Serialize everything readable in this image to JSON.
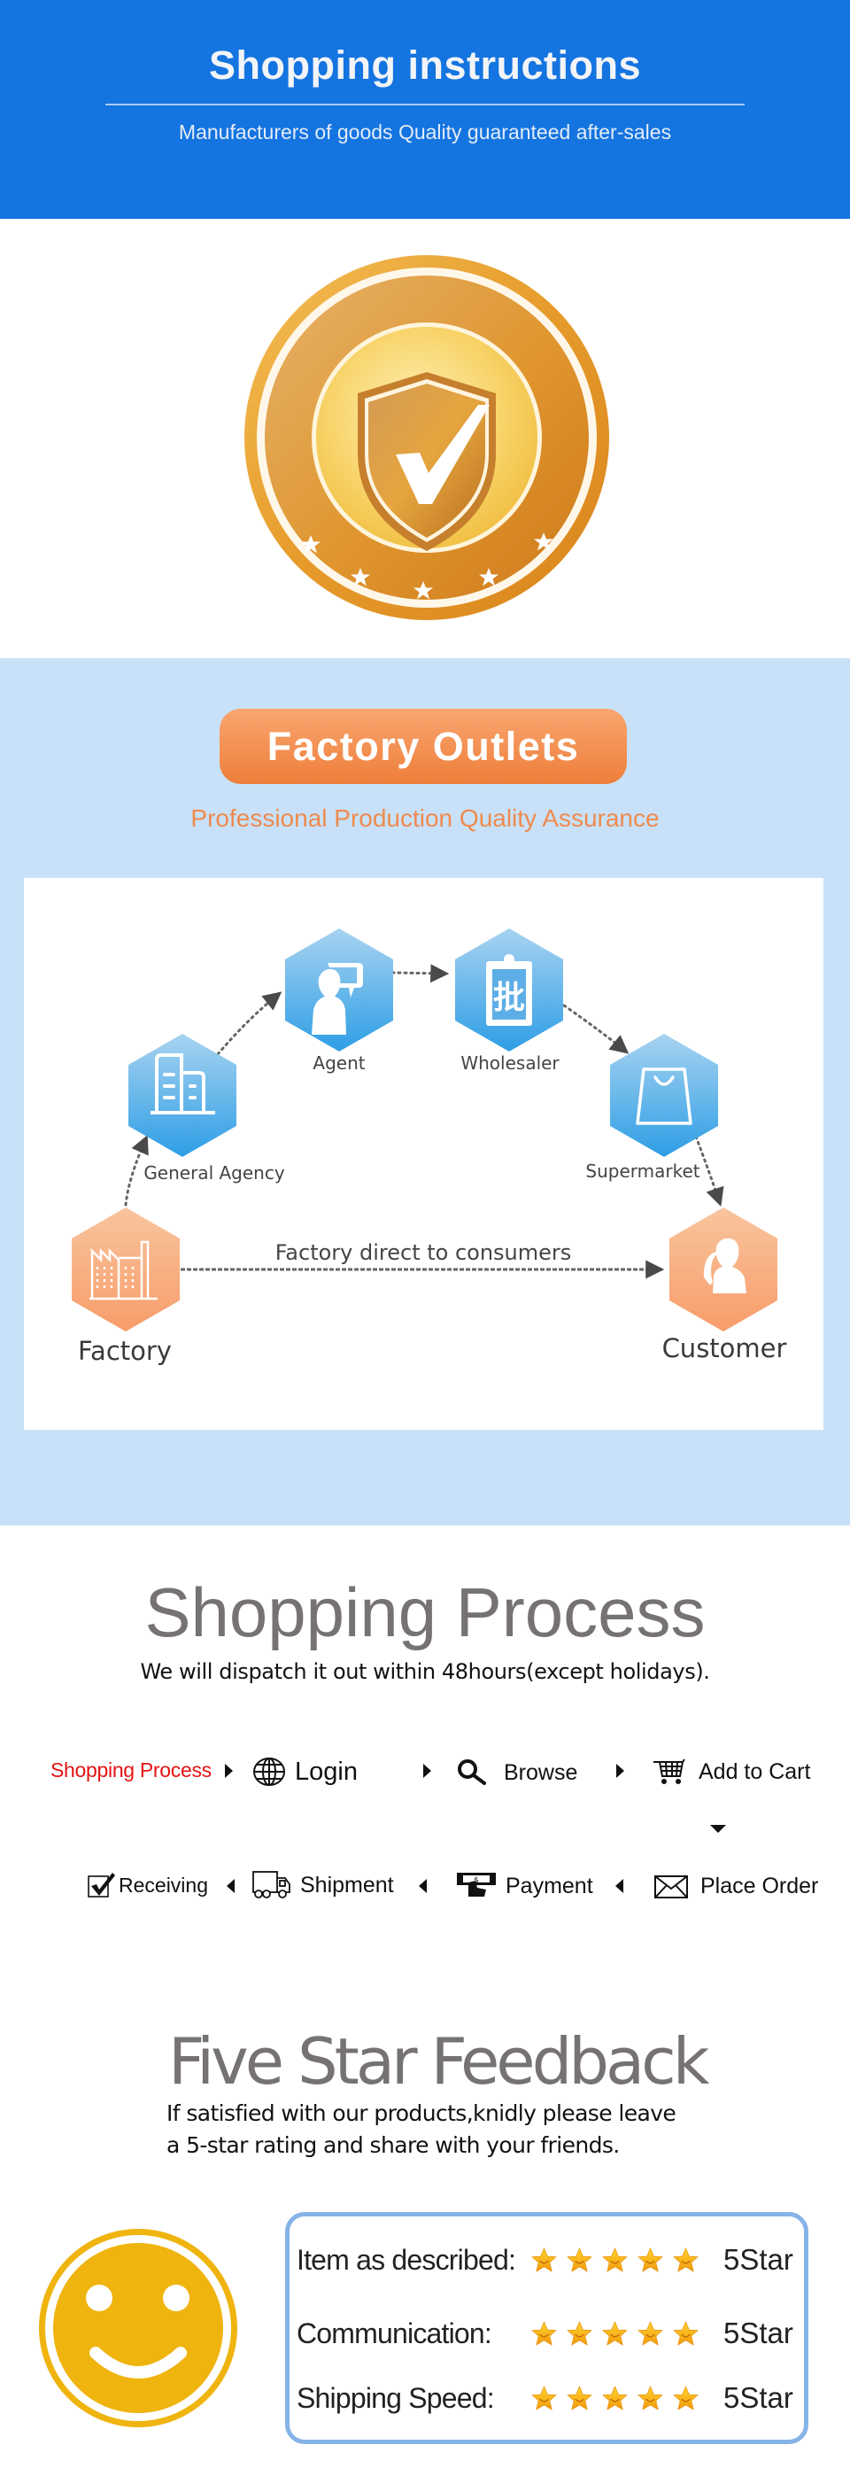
{
  "header": {
    "title": "Shopping instructions",
    "subtitle": "Manufacturers of goods Quality guaranteed after-sales",
    "background_color": "#1474E0"
  },
  "badge": {
    "icon": "shield-check-badge-icon",
    "stars": 5
  },
  "factory_outlets": {
    "button_label": "Factory Outlets",
    "subtitle": "Professional Production  Quality Assurance",
    "accent_color": "#EE7E3A",
    "background_color": "#C8E1F8",
    "diagram": {
      "nodes": [
        {
          "id": "factory",
          "label": "Factory",
          "icon": "factory-icon",
          "color": "orange"
        },
        {
          "id": "general_agency",
          "label": "General Agency",
          "icon": "office-building-icon",
          "color": "blue"
        },
        {
          "id": "agent",
          "label": "Agent",
          "icon": "person-chat-icon",
          "color": "blue"
        },
        {
          "id": "wholesaler",
          "label": "Wholesaler",
          "icon": "clipboard-wholesale-icon",
          "color": "blue"
        },
        {
          "id": "supermarket",
          "label": "Supermarket",
          "icon": "shopping-bag-icon",
          "color": "blue"
        },
        {
          "id": "customer",
          "label": "Customer",
          "icon": "customers-icon",
          "color": "orange"
        }
      ],
      "direct_label": "Factory direct to consumers",
      "edges": [
        [
          "factory",
          "general_agency"
        ],
        [
          "general_agency",
          "agent"
        ],
        [
          "agent",
          "wholesaler"
        ],
        [
          "wholesaler",
          "supermarket"
        ],
        [
          "supermarket",
          "customer"
        ],
        [
          "factory",
          "customer"
        ]
      ]
    }
  },
  "shopping_process": {
    "title": "Shopping Process",
    "subtitle": "We will dispatch it out within 48hours(except holidays).",
    "label": "Shopping Process",
    "label_color": "#E31313",
    "steps": [
      {
        "label": "Login",
        "icon": "globe-icon"
      },
      {
        "label": "Browse",
        "icon": "magnifier-icon"
      },
      {
        "label": "Add to Cart",
        "icon": "cart-icon"
      },
      {
        "label": "Place Order",
        "icon": "envelope-icon"
      },
      {
        "label": "Payment",
        "icon": "payment-icon"
      },
      {
        "label": "Shipment",
        "icon": "truck-icon"
      },
      {
        "label": "Receiving",
        "icon": "checkbox-icon"
      }
    ]
  },
  "feedback": {
    "title": "Five Star Feedback",
    "text_line1": "If satisfied with our products,knidly please leave",
    "text_line2": "a 5-star rating and share with your friends.",
    "ratings": [
      {
        "label": "Item as described:",
        "stars": 5,
        "value": "5Star"
      },
      {
        "label": "Communication:",
        "stars": 5,
        "value": "5Star"
      },
      {
        "label": "Shipping Speed:",
        "stars": 5,
        "value": "5Star"
      }
    ],
    "box_border_color": "#86B3E8",
    "smiley_color": "#F0B40F"
  }
}
